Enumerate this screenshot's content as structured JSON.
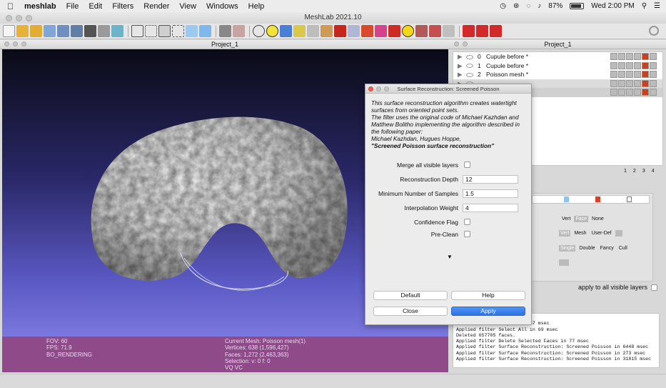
{
  "menubar": {
    "app": "meshlab",
    "menus": [
      "File",
      "Edit",
      "Filters",
      "Render",
      "View",
      "Windows",
      "Help"
    ],
    "battery": "87%",
    "battery_level": 0.87,
    "clock": "Wed 2:00 PM"
  },
  "window": {
    "title": "MeshLab 2021.10"
  },
  "viewport": {
    "title": "Project_1",
    "info_left": [
      "FOV: 60",
      "FPS:   71.9",
      "BO_RENDERING"
    ],
    "info_right": [
      "Current Mesh: Poisson mesh(1)",
      "Vertices: 638    (1,596,427)",
      "Faces: 1,272    (2,463,363)",
      "Selection: v: 0 f: 0",
      "VQ VC"
    ]
  },
  "right_panel": {
    "title": "Project_1",
    "layers": [
      {
        "id": "0",
        "name": "Cupule before *"
      },
      {
        "id": "1",
        "name": "Cupule before *"
      },
      {
        "id": "2",
        "name": "Poisson mesh *"
      },
      {
        "id": "",
        "name": ""
      },
      {
        "id": "",
        "name": ""
      }
    ],
    "pages": [
      "1",
      "2",
      "3",
      "4"
    ],
    "render_rows": [
      [
        "Vert",
        "Face",
        "None"
      ],
      [
        "Vert",
        "Mesh",
        "User-Def"
      ],
      [
        "Single",
        "Double",
        "Fancy",
        "Cull"
      ]
    ],
    "apply_all": "apply to all visible layers"
  },
  "log": [
    "               Layer 1",
    "        current layer in 137 msec",
    "Applied filter Select All in 69 msec",
    "Deleted 657705 faces.",
    "Applied filter Delete Selected Faces in 77 msec",
    "Applied filter Surface Reconstruction: Screened Poisson in 6448 msec",
    "Applied filter Surface Reconstruction: Screened Poisson in 273 msec",
    "",
    "Applied filter Surface Reconstruction: Screened Poisson in 31815 msec"
  ],
  "dialog": {
    "title": "Surface Reconstruction: Screened Poisson",
    "description": [
      "This surface reconstruction algorithm creates watertight",
      "surfaces from oriented point sets.",
      "The filter uses the original code of Michael Kazhdan and",
      "Matthew Bolitho implementing the algorithm described in",
      "the following paper:",
      "Michael Kazhdan, Hugues Hoppe,"
    ],
    "paper": "\"Screened Poisson surface reconstruction\"",
    "params": {
      "merge": "Merge all visible layers",
      "depth_label": "Reconstruction Depth",
      "depth_value": "12",
      "samples_label": "Minimum Number of Samples",
      "samples_value": "1.5",
      "weight_label": "Interpolation Weight",
      "weight_value": "4",
      "confidence": "Confidence Flag",
      "preclean": "Pre-Clean"
    },
    "more_arrow": "▼",
    "default_btn": "Default",
    "help_btn": "Help",
    "close_btn": "Close",
    "apply_btn": "Apply"
  }
}
